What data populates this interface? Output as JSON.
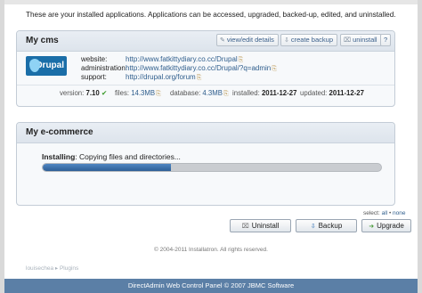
{
  "intro": "These are your installed applications. Applications can be accessed, upgraded, backed-up, edited, and uninstalled.",
  "app1": {
    "title": "My cms",
    "buttons": {
      "view_edit": "view/edit details",
      "backup": "create backup",
      "uninstall": "uninstall",
      "help": "?"
    },
    "logo_text": "Drupal",
    "website_label": "website:",
    "website_value": "http://www.fatkittydiary.co.cc/Drupal",
    "admin_label": "administration:",
    "admin_value": "http://www.fatkittydiary.co.cc/Drupal/?q=admin",
    "support_label": "support:",
    "support_value": "http://drupal.org/forum",
    "stats": {
      "version_label": "version:",
      "version_value": "7.10",
      "files_label": "files:",
      "files_value": "14.3MB",
      "database_label": "database:",
      "database_value": "4.3MB",
      "installed_label": "installed:",
      "installed_value": "2011-12-27",
      "updated_label": "updated:",
      "updated_value": "2011-12-27"
    }
  },
  "app2": {
    "title": "My e-commerce",
    "status_bold": "Installing",
    "status_rest": ": Copying files and directories...",
    "progress": 0.38
  },
  "select": {
    "label": "select:",
    "all": "all",
    "sep": "•",
    "none": "none"
  },
  "actions": {
    "uninstall": "Uninstall",
    "backup": "Backup",
    "upgrade": "Upgrade"
  },
  "copyright": "© 2004-2011 Installatron. All rights reserved.",
  "breadcrumb": "louisechea ▸ Plugins",
  "footer": "DirectAdmin Web Control Panel © 2007 JBMC Software",
  "colors": {
    "accent": "#2e5d8c",
    "footer_bg": "#5b7fa6",
    "progress": "#3a6ea8"
  }
}
